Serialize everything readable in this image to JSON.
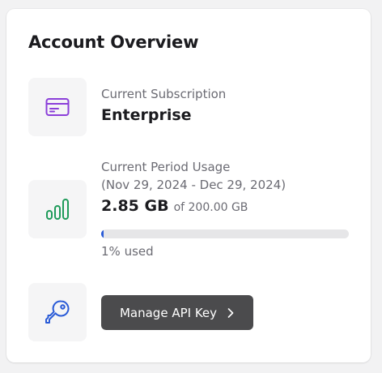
{
  "card": {
    "title": "Account Overview"
  },
  "subscription": {
    "label": "Current Subscription",
    "value": "Enterprise",
    "icon": "credit-card-icon",
    "icon_color": "#8b3fd9"
  },
  "usage": {
    "label": "Current Period Usage",
    "period": "(Nov 29, 2024 - Dec 29, 2024)",
    "amount": "2.85 GB",
    "total": "of 200.00 GB",
    "used_fraction": 0.01,
    "used_text": "1% used",
    "icon": "bar-chart-icon",
    "icon_color": "#1f9b5a",
    "bar_color": "#2a5bd7"
  },
  "api": {
    "button_label": "Manage API Key",
    "icon": "key-icon",
    "icon_color": "#2a5bd7"
  }
}
